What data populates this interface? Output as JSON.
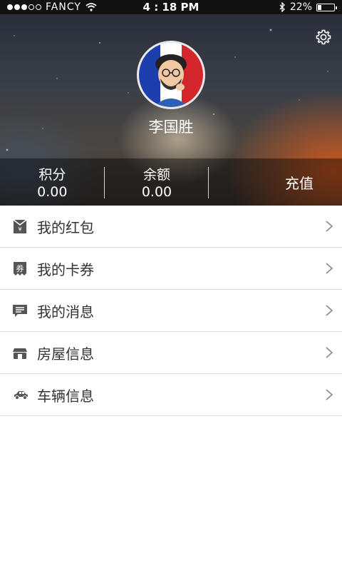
{
  "status_bar": {
    "carrier": "FANCY",
    "time": "4 : 18 PM",
    "battery": "22%"
  },
  "profile": {
    "username": "李国胜",
    "settings_icon": "gear-icon"
  },
  "stats": [
    {
      "label": "积分",
      "value": "0.00"
    },
    {
      "label": "余额",
      "value": "0.00"
    }
  ],
  "recharge_label": "充值",
  "menu": [
    {
      "label": "我的红包",
      "icon": "red-envelope-icon"
    },
    {
      "label": "我的卡券",
      "icon": "coupon-icon"
    },
    {
      "label": "我的消息",
      "icon": "message-icon"
    },
    {
      "label": "房屋信息",
      "icon": "house-icon"
    },
    {
      "label": "车辆信息",
      "icon": "car-icon"
    }
  ],
  "colors": {
    "icon_gray": "#555555",
    "divider": "#dddddd"
  }
}
